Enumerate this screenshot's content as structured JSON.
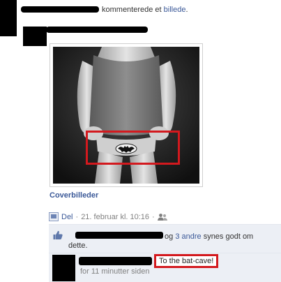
{
  "header": {
    "action_text": "kommenterede et",
    "target_link": "billede",
    "trailing": "."
  },
  "photo": {
    "caption": "Coverbilleder",
    "logo_icon": "bat-logo-icon"
  },
  "meta": {
    "share_label": "Del",
    "separator": "·",
    "date": "21. februar kl. 10:16",
    "audience_icon": "friends-icon"
  },
  "likes": {
    "connector": "og",
    "others_link": "3 andre",
    "suffix": "synes godt om",
    "line2": "dette."
  },
  "comment": {
    "text": "To the bat-cave!",
    "time": "for 11 minutter siden"
  },
  "colors": {
    "link": "#3b5998",
    "highlight_red": "#d3191e",
    "panel_bg": "#eceff5"
  }
}
